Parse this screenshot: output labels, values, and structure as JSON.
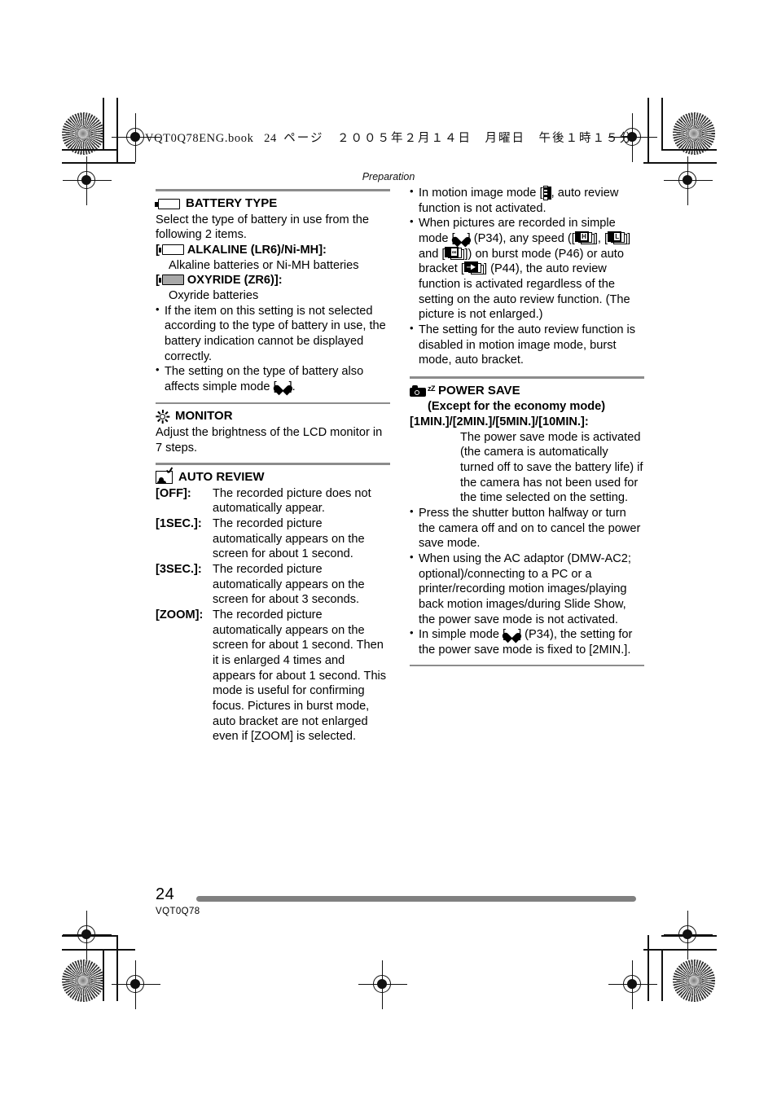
{
  "print_marks": {
    "book_stamp": "VQT0Q78ENG.book",
    "book_stamp_page": "24",
    "book_stamp_jp": "ページ　２００５年２月１４日　月曜日　午後１時１５分"
  },
  "running_head": "Preparation",
  "left_column": {
    "battery_type": {
      "icon": "battery-outline-icon",
      "heading": "BATTERY TYPE",
      "intro": "Select the type of battery in use from the following 2 items.",
      "options": [
        {
          "icon": "battery-outline-icon",
          "label_open": "[",
          "label": "ALKALINE (LR6)/Ni-MH]:",
          "description": "Alkaline batteries or Ni-MH batteries"
        },
        {
          "icon": "battery-filled-icon",
          "label_open": "[",
          "label": "OXYRIDE (ZR6)]:",
          "description": "Oxyride batteries"
        }
      ],
      "notes": [
        "If the item on this setting is not selected according to the type of battery in use, the battery indication cannot be displayed correctly.",
        "The setting on the type of battery also affects simple mode [",
        "]."
      ]
    },
    "monitor": {
      "icon": "sun-brightness-icon",
      "heading": "MONITOR",
      "body": "Adjust the brightness of the LCD monitor in 7 steps."
    },
    "auto_review": {
      "icon": "picture-check-icon",
      "heading": "AUTO REVIEW",
      "items": [
        {
          "term": "[OFF]:",
          "definition": "The recorded picture does not automatically appear."
        },
        {
          "term": "[1SEC.]:",
          "definition": "The recorded picture automatically appears on the screen for about 1 second."
        },
        {
          "term": "[3SEC.]:",
          "definition": "The recorded picture automatically appears on the screen for about 3 seconds."
        },
        {
          "term": "[ZOOM]:",
          "definition": "The recorded picture automatically appears on the screen for about 1 second. Then it is enlarged 4 times and appears for about 1 second. This mode is useful for confirming focus. Pictures in burst mode, auto bracket are not enlarged even if [ZOOM] is selected."
        }
      ]
    }
  },
  "right_column": {
    "auto_review_notes": {
      "note1_a": "In motion image mode [",
      "note1_icon": "motion-picture-film-icon",
      "note1_b": "], auto review function is not activated.",
      "note2_a": "When pictures are recorded in simple mode [",
      "note2_heart": "simple-mode-heart-icon",
      "note2_b": "] (P34), any speed ([",
      "note2_burst_h": "burst-high-icon",
      "note2_c": "], [",
      "note2_burst_l": "burst-low-icon",
      "note2_d": "] and [",
      "note2_burst_inf": "burst-infinite-icon",
      "note2_e": "]) on burst mode (P46) or auto bracket [",
      "note2_bracket": "auto-bracket-icon",
      "note2_f": "] (P44), the auto review function is activated regardless of the setting on the auto review function. (The picture is not enlarged.)",
      "note3": "The setting for the auto review function is disabled in motion image mode, burst mode, auto bracket."
    },
    "power_save": {
      "icon": "camera-sleep-icon",
      "icon_zz": "zZ",
      "heading": "POWER SAVE",
      "subheading": "(Except for the economy mode)",
      "term": "[1MIN.]/[2MIN.]/[5MIN.]/[10MIN.]:",
      "definition": "The power save mode is activated (the camera is automatically turned off to save the battery life) if the camera has not been used for the time selected on the setting.",
      "notes": [
        "Press the shutter button halfway or turn the camera off and on to cancel the power save mode.",
        "When using the AC adaptor (DMW-AC2; optional)/connecting to a PC or a printer/recording motion images/playing back motion images/during Slide Show, the power save mode is not activated."
      ],
      "note_simple_a": "In simple mode [",
      "note_simple_icon": "simple-mode-heart-icon",
      "note_simple_b": "] (P34), the setting for the power save mode is fixed to [2MIN.]."
    }
  },
  "footer": {
    "page_number": "24",
    "doc_code": "VQT0Q78"
  },
  "colors": {
    "rule_gray": "#8c8c8c",
    "footer_bar_gray": "#808080",
    "battery_fill_gray": "#a8a8a8",
    "text_black": "#000000"
  }
}
